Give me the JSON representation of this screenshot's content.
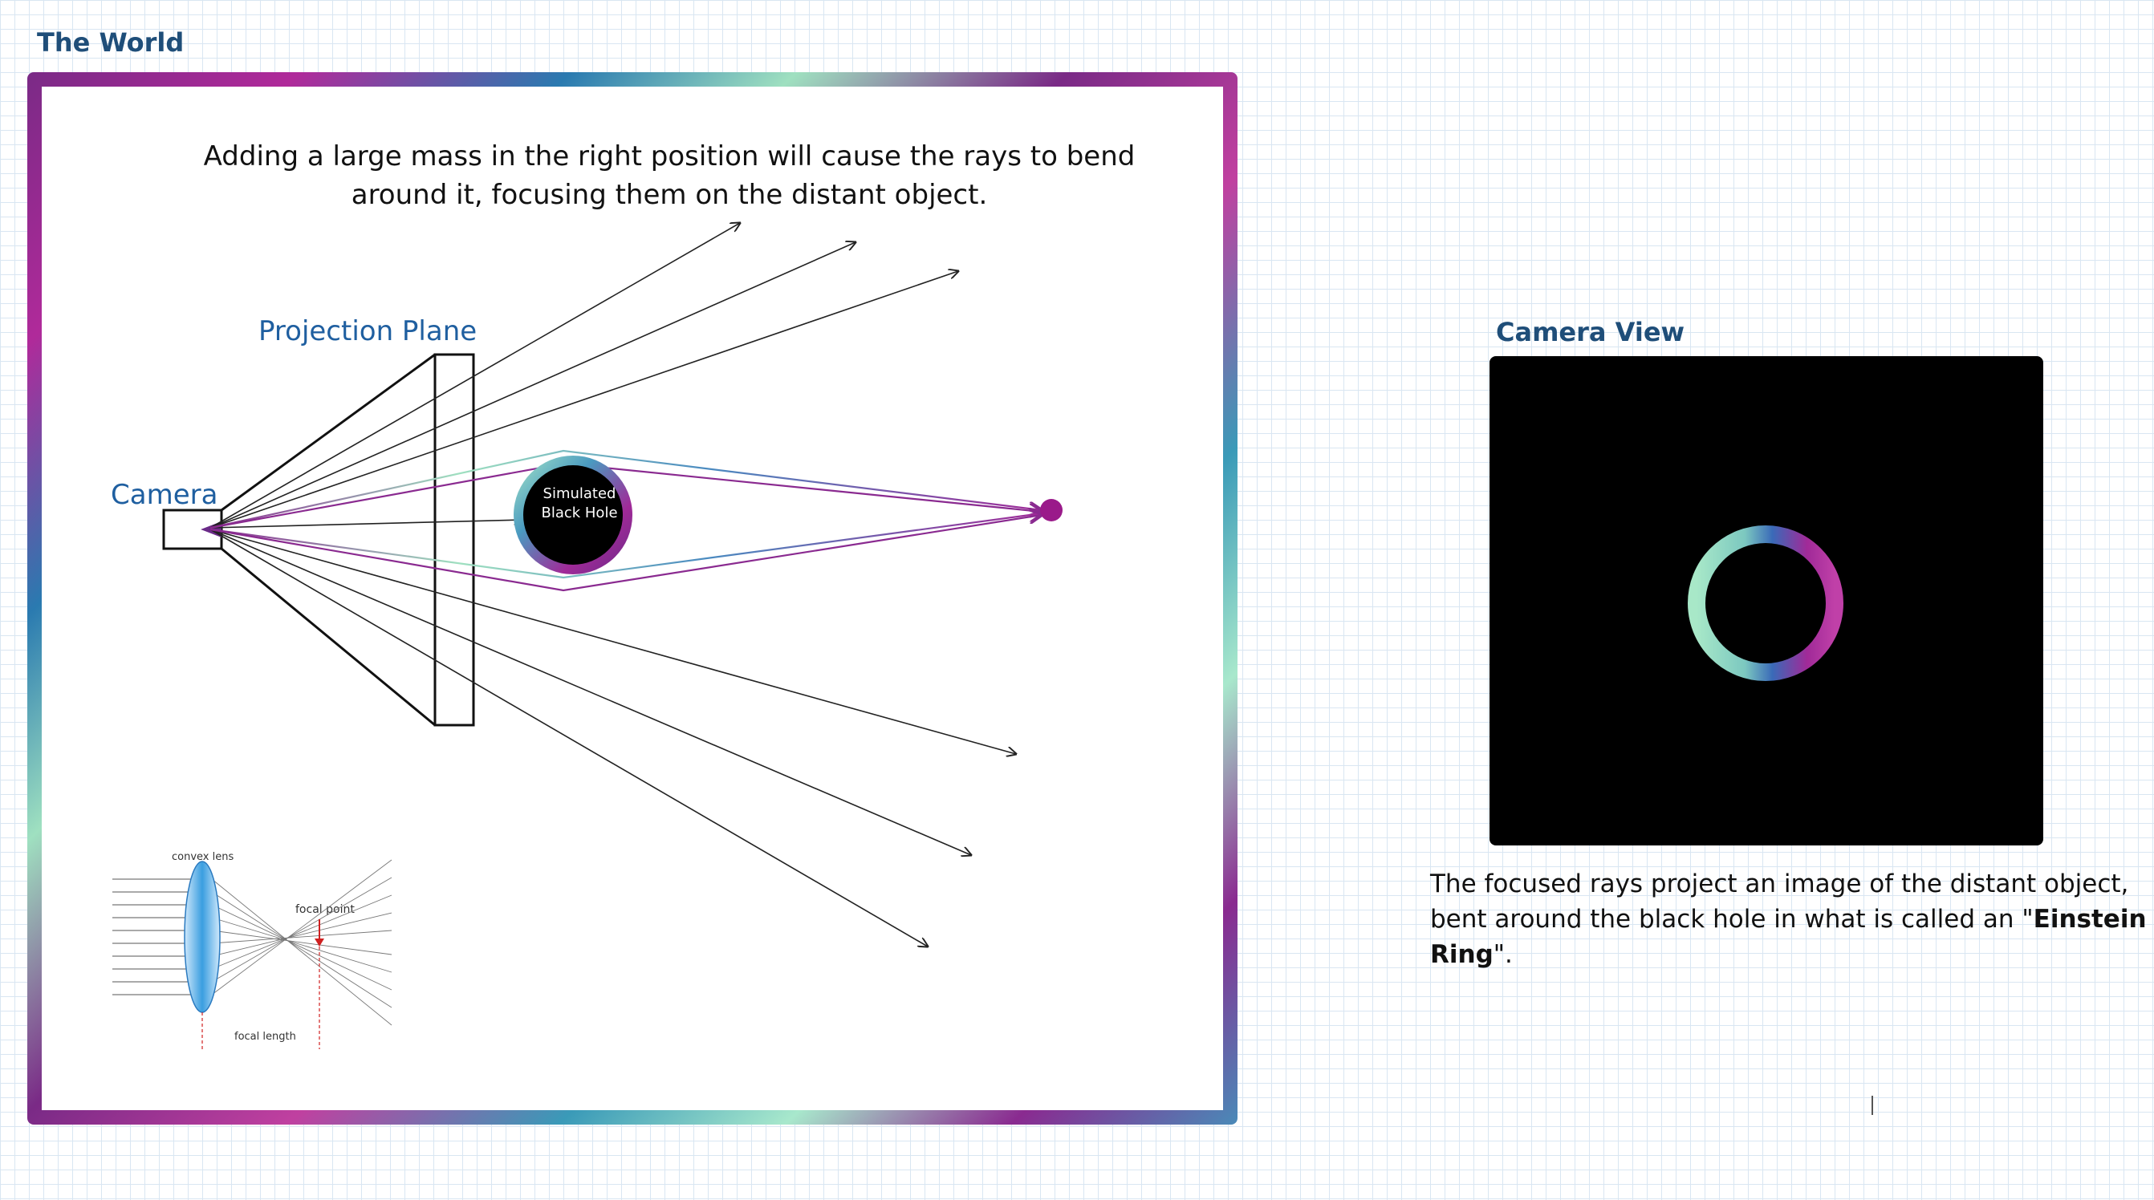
{
  "world": {
    "title": "The World",
    "caption_line1": "Adding a large mass in the right position will cause the rays to bend",
    "caption_line2": "around it, focusing them on the distant object.",
    "projection_plane_label": "Projection Plane",
    "camera_label": "Camera",
    "black_hole_line1": "Simulated",
    "black_hole_line2": "Black Hole"
  },
  "lens_inset": {
    "convex_lens_label": "convex lens",
    "focal_point_label": "focal point",
    "focal_length_label": "focal length"
  },
  "camera_view": {
    "title": "Camera View"
  },
  "description": {
    "text_before": "The focused rays project an image of the distant object, bent around the black hole in what is called an \"",
    "bold_term": "Einstein Ring",
    "text_after": "\"."
  },
  "colors": {
    "heading": "#1f4e79",
    "label_blue": "#1f5fa0",
    "ray_purple": "#8a2a90",
    "ray_teal": "#4aa8b8",
    "ring_green": "#9fe0c0",
    "ring_purple": "#9a2a9a",
    "target_dot": "#9a1a8a"
  }
}
